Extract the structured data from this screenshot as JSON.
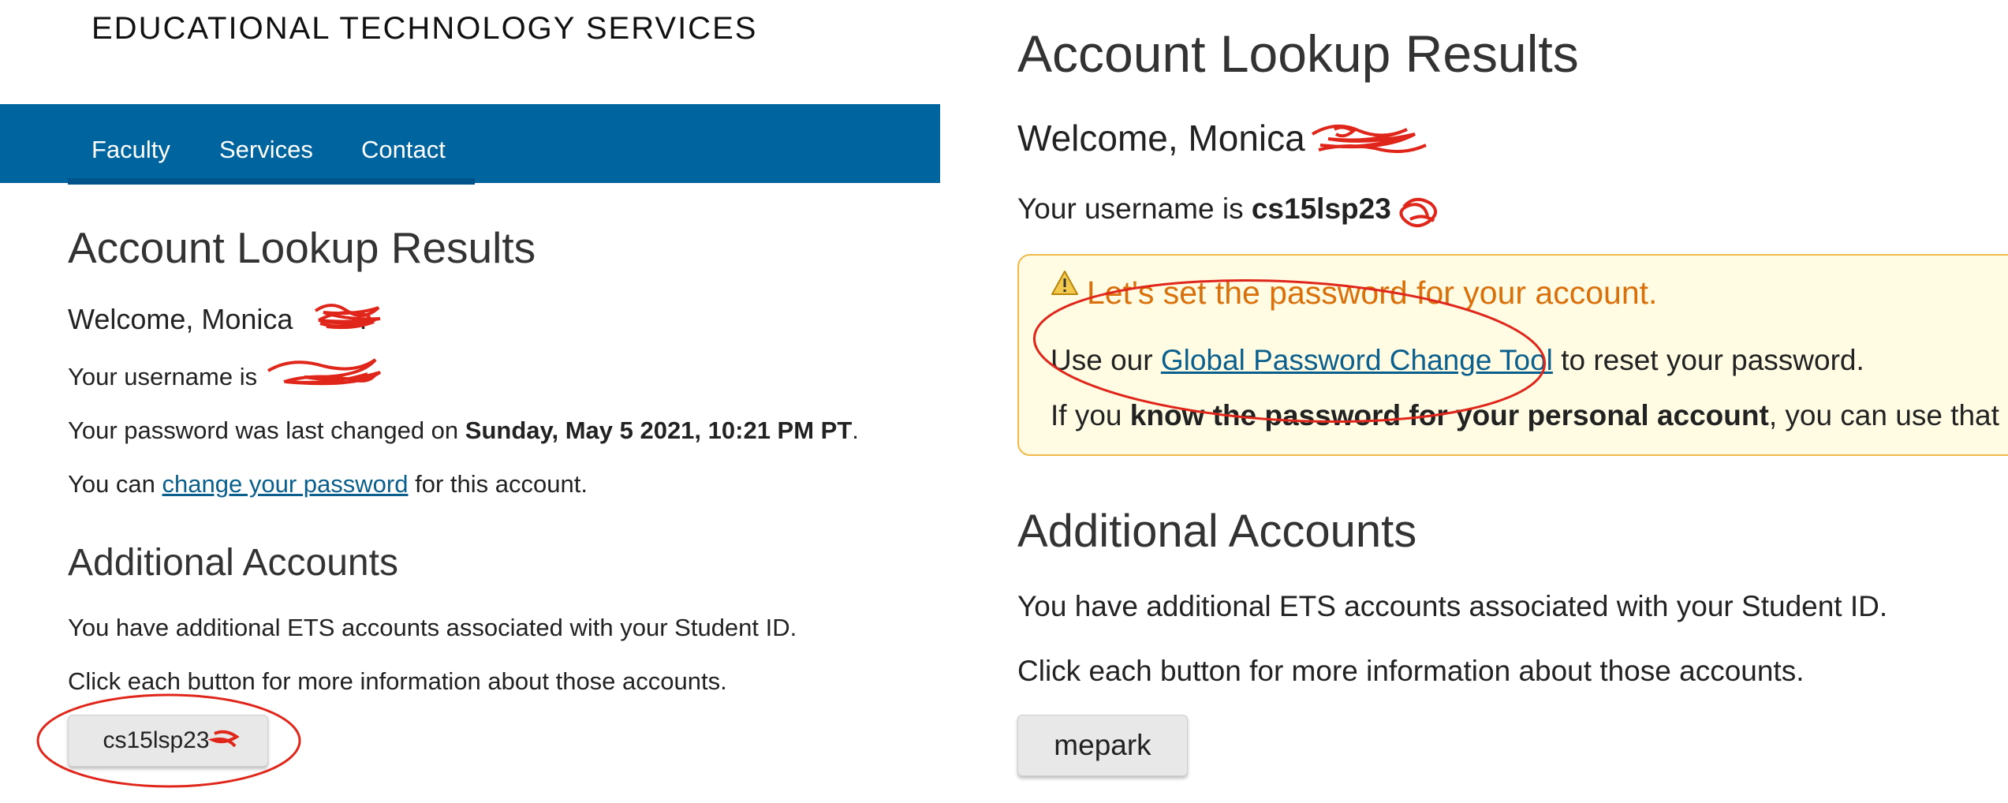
{
  "left": {
    "brand": "EDUCATIONAL TECHNOLOGY SERVICES",
    "nav": {
      "faculty": "Faculty",
      "services": "Services",
      "contact": "Contact"
    },
    "title": "Account Lookup Results",
    "welcome": "Welcome, Monica",
    "welcome_period": ".",
    "username_prefix": "Your username is",
    "password_changed_prefix": "Your password was last changed on",
    "password_changed_date": "Sunday, May 5 2021, 10:21 PM PT",
    "password_changed_suffix": ".",
    "change_prefix": "You can",
    "change_link": "change your password",
    "change_suffix": "for this account.",
    "additional_title": "Additional Accounts",
    "additional_text": "You have additional ETS accounts associated with your Student ID.",
    "click_text": "Click each button for more information about those accounts.",
    "account_button": "cs15lsp23"
  },
  "right": {
    "title": "Account Lookup Results",
    "welcome": "Welcome, Monica",
    "username_prefix": "Your username is",
    "username": "cs15lsp23",
    "alert": {
      "title": "Let's set the password for your account.",
      "use_prefix": "Use our",
      "tool_link": "Global Password Change Tool",
      "use_suffix": "to reset your password.",
      "if_prefix": "If you",
      "if_bold": "know the password for your personal account",
      "if_suffix": ", you can use that p"
    },
    "additional_title": "Additional Accounts",
    "additional_text": "You have additional ETS accounts associated with your Student ID.",
    "click_text": "Click each button for more information about those accounts.",
    "account_button": "mepark"
  },
  "colors": {
    "nav_bg": "#00659e",
    "link": "#0a5f8c",
    "alert_bg": "#fffce3",
    "alert_border": "#f0b84a",
    "alert_title": "#d9700b",
    "annotation_red": "#e0261b"
  },
  "icons": {
    "alert_icon": "warning-triangle-icon"
  }
}
